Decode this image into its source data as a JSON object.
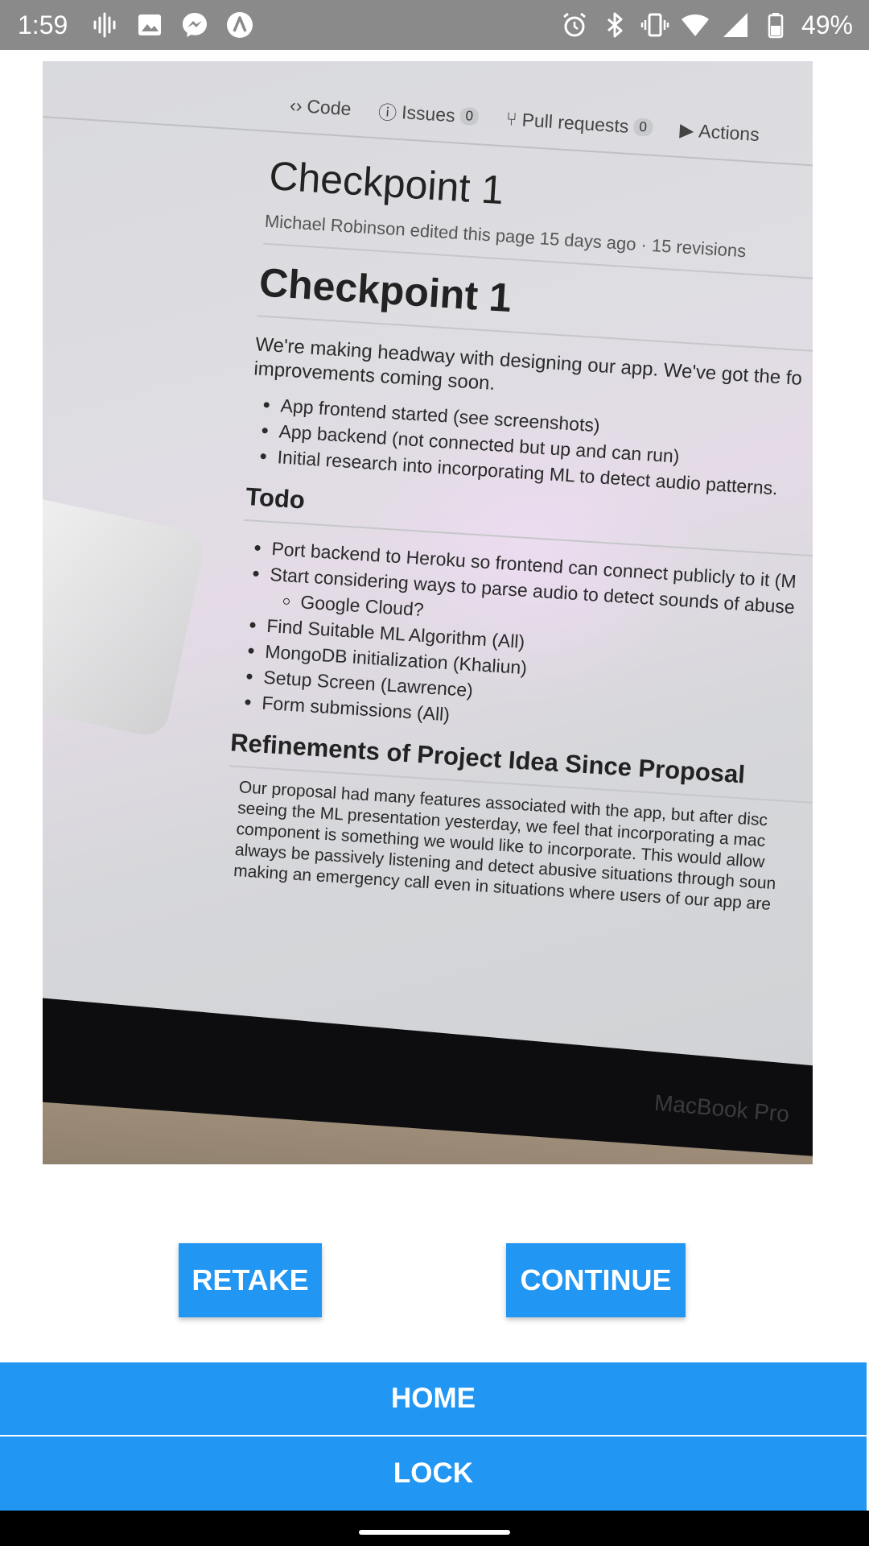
{
  "status_bar": {
    "time": "1:59",
    "battery": "49%",
    "left_icons": [
      "pulse-icon",
      "image-icon",
      "messenger-icon",
      "app-a-icon"
    ],
    "right_icons": [
      "alarm-icon",
      "bluetooth-icon",
      "vibrate-icon",
      "wifi-icon",
      "signal-icon",
      "battery-icon"
    ]
  },
  "photo": {
    "tabs": [
      {
        "icon": "code-icon",
        "label": "Code"
      },
      {
        "icon": "issue-icon",
        "label": "Issues",
        "count": "0"
      },
      {
        "icon": "pull-request-icon",
        "label": "Pull requests",
        "count": "0"
      },
      {
        "icon": "actions-icon",
        "label": "Actions"
      }
    ],
    "wiki_title": "Checkpoint 1",
    "wiki_meta": "Michael Robinson edited this page 15 days ago · 15 revisions",
    "heading": "Checkpoint 1",
    "intro_line1": "We're making headway with designing our app. We've got the fo",
    "intro_line2": "improvements coming soon.",
    "progress_items": [
      "App frontend started (see screenshots)",
      "App backend (not connected but up and can run)",
      "Initial research into incorporating ML to detect audio patterns."
    ],
    "todo_heading": "Todo",
    "todo_items": [
      "Port backend to Heroku so frontend can connect publicly to it (M",
      "Start considering ways to parse audio to detect sounds of abuse",
      "Google Cloud?",
      "Find Suitable ML Algorithm (All)",
      "MongoDB initialization (Khaliun)",
      "Setup Screen (Lawrence)",
      "Form submissions (All)"
    ],
    "refine_heading": "Refinements of Project Idea Since Proposal",
    "refine_lines": [
      "Our proposal had many features associated with the app, but after disc",
      "seeing the ML presentation yesterday, we feel that incorporating a mac",
      "component is something we would like to incorporate. This would allow",
      "always be passively listening and detect abusive situations through soun",
      "making an emergency call even in situations where users of our app are"
    ],
    "laptop_label": "MacBook Pro"
  },
  "actions": {
    "retake": "RETAKE",
    "continue": "CONTINUE",
    "home": "HOME",
    "lock": "LOCK"
  },
  "colors": {
    "accent": "#2196f3",
    "status_bar": "#8a8a8a",
    "nav_bar": "#000000"
  }
}
